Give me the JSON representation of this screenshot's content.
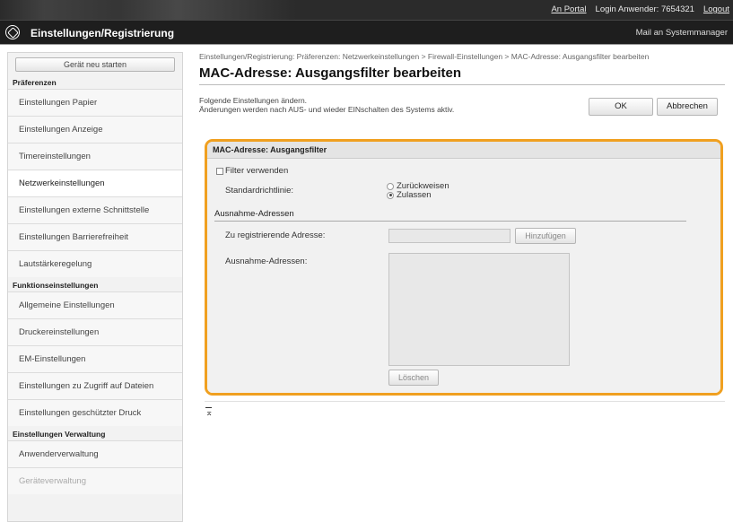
{
  "header": {
    "portal_link": "An Portal",
    "login_label": "Login Anwender:",
    "login_user": "7654321",
    "logout": "Logout",
    "app_title": "Einstellungen/Registrierung",
    "mail_link": "Mail an Systemmanager"
  },
  "sidebar": {
    "restart_label": "Gerät neu starten",
    "sections": [
      {
        "title": "Präferenzen",
        "items": [
          {
            "label": "Einstellungen Papier",
            "active": false
          },
          {
            "label": "Einstellungen Anzeige",
            "active": false
          },
          {
            "label": "Timereinstellungen",
            "active": false
          },
          {
            "label": "Netzwerkeinstellungen",
            "active": true
          },
          {
            "label": "Einstellungen externe Schnittstelle",
            "active": false
          },
          {
            "label": "Einstellungen Barrierefreiheit",
            "active": false
          },
          {
            "label": "Lautstärkeregelung",
            "active": false
          }
        ]
      },
      {
        "title": "Funktionseinstellungen",
        "items": [
          {
            "label": "Allgemeine Einstellungen",
            "active": false
          },
          {
            "label": "Druckereinstellungen",
            "active": false
          },
          {
            "label": "EM-Einstellungen",
            "active": false
          },
          {
            "label": "Einstellungen zu Zugriff auf Dateien",
            "active": false
          },
          {
            "label": "Einstellungen geschützter Druck",
            "active": false
          }
        ]
      },
      {
        "title": "Einstellungen Verwaltung",
        "items": [
          {
            "label": "Anwenderverwaltung",
            "active": false
          },
          {
            "label": "Geräteverwaltung",
            "active": false
          }
        ]
      }
    ]
  },
  "main": {
    "breadcrumb": "Einstellungen/Registrierung: Präferenzen: Netzwerkeinstellungen > Firewall-Einstellungen > MAC-Adresse: Ausgangsfilter bearbeiten",
    "page_title": "MAC-Adresse: Ausgangsfilter bearbeiten",
    "note_line1": "Folgende Einstellungen ändern.",
    "note_line2": "Änderungen werden nach AUS- und wieder EINschalten des Systems aktiv.",
    "ok_button": "OK",
    "cancel_button": "Abbrechen",
    "panel": {
      "title": "MAC-Adresse: Ausgangsfilter",
      "use_filter_label": "Filter verwenden",
      "use_filter_checked": false,
      "default_policy_label": "Standardrichtlinie:",
      "policy_options": [
        "Zurückweisen",
        "Zulassen"
      ],
      "policy_selected": "Zulassen",
      "exceptions_heading": "Ausnahme-Adressen",
      "register_address_label": "Zu registrierende Adresse:",
      "register_address_value": "",
      "add_button": "Hinzufügen",
      "exception_list_label": "Ausnahme-Adressen:",
      "exception_list": [],
      "delete_button": "Löschen"
    },
    "to_top_icon": "to-top-icon"
  },
  "colors": {
    "highlight_border": "#f0a020",
    "title_bar": "#1e1e1e"
  }
}
